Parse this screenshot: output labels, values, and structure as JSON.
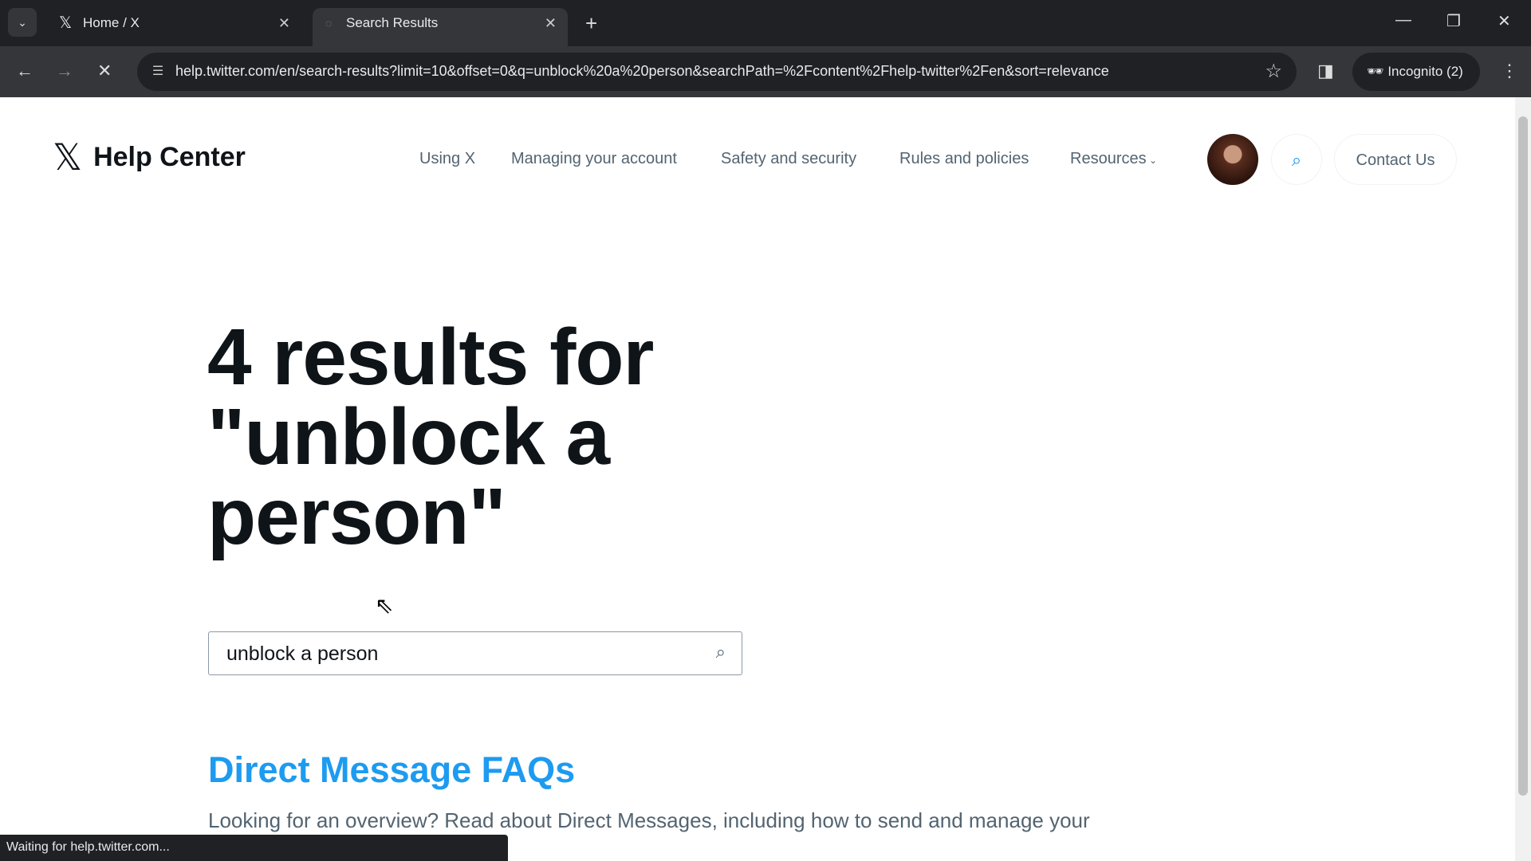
{
  "browser": {
    "tabs": [
      {
        "label": "Home / X",
        "icon": "x-logo-icon"
      },
      {
        "label": "Search Results",
        "icon": "loading-icon"
      }
    ],
    "url": "help.twitter.com/en/search-results?limit=10&offset=0&q=unblock%20a%20person&searchPath=%2Fcontent%2Fhelp-twitter%2Fen&sort=relevance",
    "incognito_label": "Incognito (2)",
    "status_text": "Waiting for help.twitter.com..."
  },
  "header": {
    "brand": "Help Center",
    "nav": [
      "Using X",
      "Managing your account",
      "Safety and security",
      "Rules and policies",
      "Resources"
    ],
    "contact_label": "Contact Us"
  },
  "main": {
    "heading": "4 results for \"unblock a person\"",
    "search_value": "unblock a person",
    "results": [
      {
        "title": "Direct Message FAQs",
        "description": "Looking for an overview? Read about Direct Messages, including how to send and manage your"
      }
    ]
  },
  "colors": {
    "accent": "#1d9bf0",
    "text": "#0f1419",
    "muted": "#536471"
  }
}
